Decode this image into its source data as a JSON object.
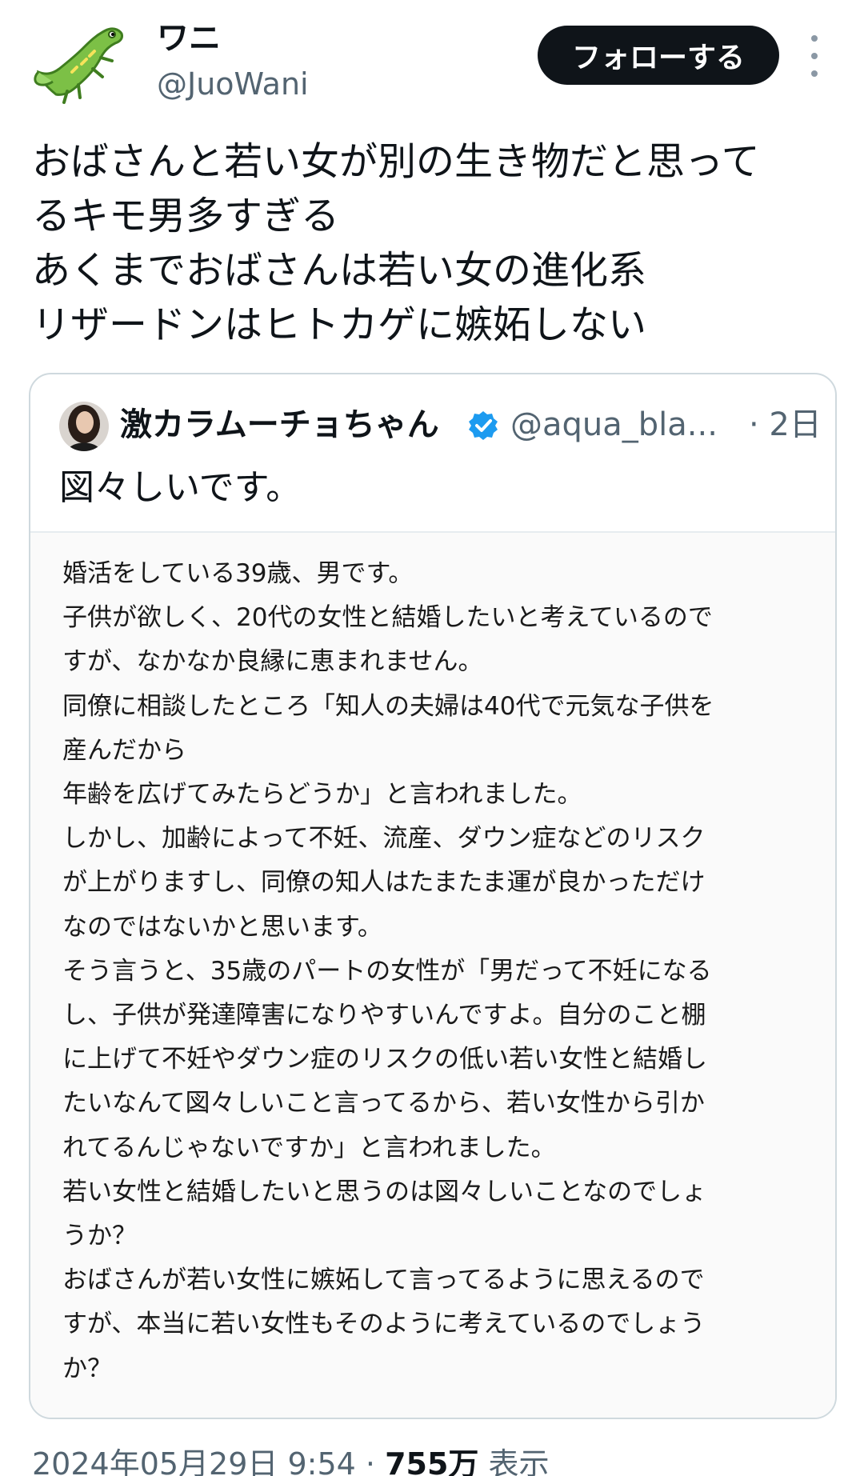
{
  "author": {
    "display_name": "ワニ",
    "handle": "@JuoWani",
    "avatar_icon": "crocodile-icon"
  },
  "actions": {
    "follow_label": "フォローする",
    "more_icon": "more-vertical-icon"
  },
  "tweet": {
    "lines": [
      "おばさんと若い女が別の生き物だと思って",
      "るキモ男多すぎる",
      "あくまでおばさんは若い女の進化系",
      "リザードンはヒトカゲに嫉妬しない"
    ]
  },
  "quote": {
    "display_name": "激カラムーチョちゃん",
    "verified_icon": "verified-badge-icon",
    "handle": "@aqua_bla...",
    "time": "· 2日",
    "text": "図々しいです。",
    "image_lines": [
      "婚活をしている39歳、男です。",
      "子供が欲しく、20代の女性と結婚したいと考えているので",
      "すが、なかなか良縁に恵まれません。",
      "同僚に相談したところ「知人の夫婦は40代で元気な子供を",
      "産んだから",
      "年齢を広げてみたらどうか」と言われました。",
      "しかし、加齢によって不妊、流産、ダウン症などのリスク",
      "が上がりますし、同僚の知人はたまたま運が良かっただけ",
      "なのではないかと思います。",
      "そう言うと、35歳のパートの女性が「男だって不妊になる",
      "し、子供が発達障害になりやすいんですよ。自分のこと棚",
      "に上げて不妊やダウン症のリスクの低い若い女性と結婚し",
      "たいなんて図々しいこと言ってるから、若い女性から引か",
      "れてるんじゃないですか」と言われました。",
      "若い女性と結婚したいと思うのは図々しいことなのでしょ",
      "うか？",
      "おばさんが若い女性に嫉妬して言ってるように思えるので",
      "すが、本当に若い女性もそのように考えているのでしょう",
      "か？"
    ]
  },
  "footer": {
    "date": "2024年05月29日 9:54 · ",
    "views": "755万",
    "views_suffix": " 表示"
  },
  "colors": {
    "follow_bg": "#0f1419",
    "secondary_text": "#536471",
    "border": "#cfd9de",
    "verified": "#1d9bf0"
  }
}
